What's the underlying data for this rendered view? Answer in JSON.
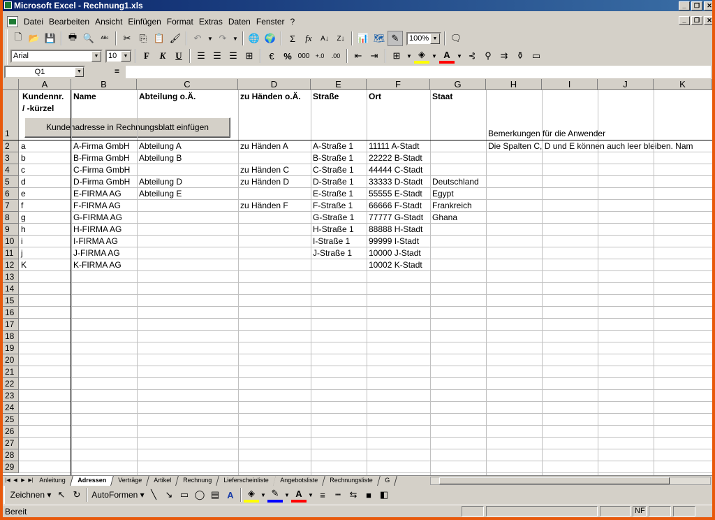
{
  "window": {
    "title": "Microsoft Excel - Rechnung1.xls",
    "controls": [
      "_",
      "❐",
      "✕"
    ],
    "doc_controls": [
      "_",
      "❐",
      "✕"
    ]
  },
  "menu": [
    "Datei",
    "Bearbeiten",
    "Ansicht",
    "Einfügen",
    "Format",
    "Extras",
    "Daten",
    "Fenster",
    "?"
  ],
  "toolbar": {
    "zoom": "100%",
    "font_name": "Arial",
    "font_size": "10",
    "bold": "F",
    "italic": "K",
    "underline": "U",
    "sum": "Σ",
    "fx": "fx",
    "percent": "%",
    "thousands": "000",
    "euro": "€"
  },
  "formula_bar": {
    "cell_ref": "Q1",
    "eq": "=",
    "value": ""
  },
  "columns": [
    "A",
    "B",
    "C",
    "D",
    "E",
    "F",
    "G",
    "H",
    "I",
    "J",
    "K"
  ],
  "header_row": {
    "a1": "Kundennr.",
    "a1b": "/ -kürzel",
    "b": "Name",
    "c": "Abteilung o.Ä.",
    "d": "zu Händen o.Ä.",
    "e": "Straße",
    "f": "Ort",
    "g": "Staat",
    "h": "Bemerkungen für die Anwender"
  },
  "macro_button": "Kundenadresse in Rechnungsblatt einfügen",
  "rows": [
    {
      "n": "2",
      "a": "a",
      "b": "A-Firma GmbH",
      "c": "Abteilung A",
      "d": "zu Händen A",
      "e": "A-Straße 1",
      "f": "11111 A-Stadt",
      "g": "",
      "h": "Die Spalten C, D und E können auch leer bleiben. Nam"
    },
    {
      "n": "3",
      "a": "b",
      "b": "B-Firma GmbH",
      "c": "Abteilung B",
      "d": "",
      "e": "B-Straße 1",
      "f": "22222 B-Stadt",
      "g": "",
      "h": ""
    },
    {
      "n": "4",
      "a": "c",
      "b": "C-Firma GmbH",
      "c": "",
      "d": "zu Händen C",
      "e": "C-Straße 1",
      "f": "44444 C-Stadt",
      "g": "",
      "h": ""
    },
    {
      "n": "5",
      "a": "d",
      "b": "D-Firma GmbH",
      "c": "Abteilung D",
      "d": "zu Händen D",
      "e": "D-Straße 1",
      "f": "33333 D-Stadt",
      "g": "Deutschland",
      "h": ""
    },
    {
      "n": "6",
      "a": "e",
      "b": "E-FIRMA AG",
      "c": "Abteilung E",
      "d": "",
      "e": "E-Straße 1",
      "f": "55555 E-Stadt",
      "g": "Egypt",
      "h": ""
    },
    {
      "n": "7",
      "a": "f",
      "b": "F-FIRMA AG",
      "c": "",
      "d": "zu Händen F",
      "e": "F-Straße 1",
      "f": "66666 F-Stadt",
      "g": "Frankreich",
      "h": ""
    },
    {
      "n": "8",
      "a": "g",
      "b": "G-FIRMA AG",
      "c": "",
      "d": "",
      "e": "G-Straße 1",
      "f": "77777 G-Stadt",
      "g": "Ghana",
      "h": ""
    },
    {
      "n": "9",
      "a": "h",
      "b": "H-FIRMA AG",
      "c": "",
      "d": "",
      "e": "H-Straße 1",
      "f": "88888 H-Stadt",
      "g": "",
      "h": ""
    },
    {
      "n": "10",
      "a": "i",
      "b": "I-FIRMA AG",
      "c": "",
      "d": "",
      "e": "I-Straße 1",
      "f": "99999 I-Stadt",
      "g": "",
      "h": ""
    },
    {
      "n": "11",
      "a": "j",
      "b": "J-FIRMA AG",
      "c": "",
      "d": "",
      "e": "J-Straße 1",
      "f": "10000 J-Stadt",
      "g": "",
      "h": ""
    },
    {
      "n": "12",
      "a": "K",
      "b": "K-FIRMA AG",
      "c": "",
      "d": "",
      "e": "",
      "f": "10002 K-Stadt",
      "g": "",
      "h": ""
    }
  ],
  "empty_rows": [
    "13",
    "14",
    "15",
    "16",
    "17",
    "18",
    "19",
    "20",
    "21",
    "22",
    "23",
    "24",
    "25",
    "26",
    "27",
    "28",
    "29"
  ],
  "row1_label": "1",
  "sheet_tabs": [
    "Anleitung",
    "Adressen",
    "Verträge",
    "Artikel",
    "Rechnung",
    "Lieferscheinliste",
    "Angebotsliste",
    "Rechnungsliste",
    "G"
  ],
  "active_tab": "Adressen",
  "drawing": {
    "draw_label": "Zeichnen",
    "autoshapes_label": "AutoFormen"
  },
  "status": {
    "text": "Bereit",
    "nf": "NF"
  }
}
